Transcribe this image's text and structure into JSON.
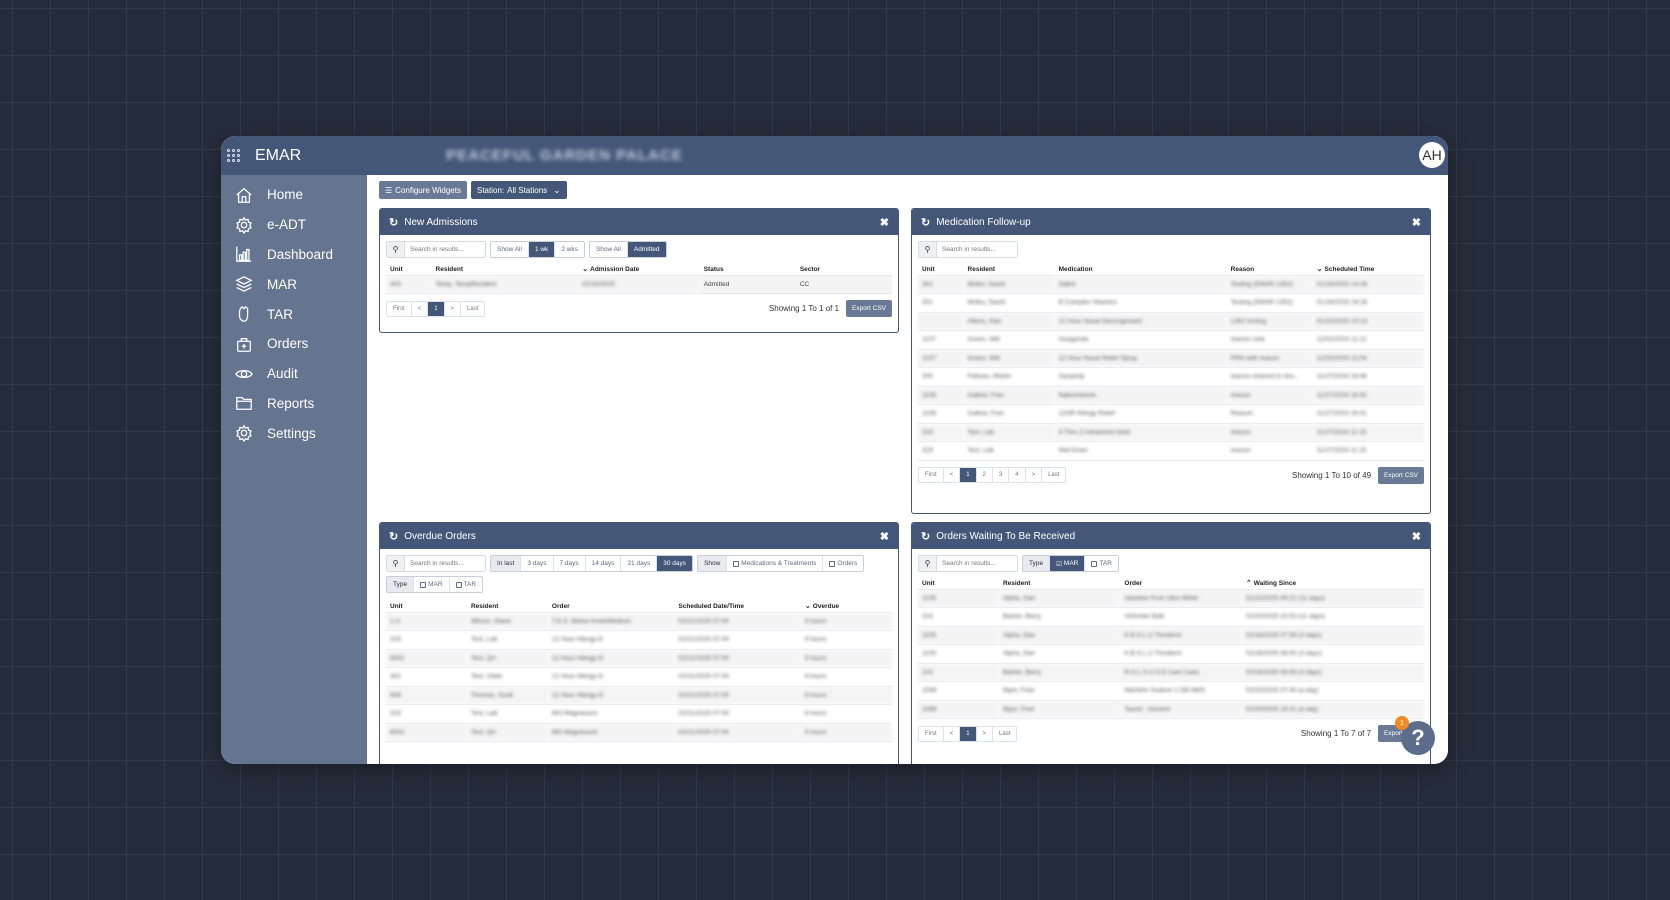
{
  "app": {
    "title": "EMAR",
    "facility_name": "PEACEFUL GARDEN PALACE",
    "avatar_initials": "AH"
  },
  "sidebar": {
    "items": [
      {
        "label": "Home",
        "icon": "home-icon"
      },
      {
        "label": "e-ADT",
        "icon": "gear-icon"
      },
      {
        "label": "Dashboard",
        "icon": "bar-chart-icon"
      },
      {
        "label": "MAR",
        "icon": "layers-icon"
      },
      {
        "label": "TAR",
        "icon": "hand-icon"
      },
      {
        "label": "Orders",
        "icon": "medical-bag-icon"
      },
      {
        "label": "Audit",
        "icon": "eye-icon"
      },
      {
        "label": "Reports",
        "icon": "folder-icon"
      },
      {
        "label": "Settings",
        "icon": "gear-icon"
      }
    ]
  },
  "toolbar": {
    "configure_label": "Configure Widgets",
    "station_label": "Station:",
    "station_value": "All Stations"
  },
  "widgets": {
    "new_admissions": {
      "title": "New Admissions",
      "search_placeholder": "Search in results...",
      "range_options": [
        "Show All",
        "1 wk",
        "2 wks"
      ],
      "range_selected": "1 wk",
      "status_options": [
        "Show All",
        "Admitted"
      ],
      "status_selected": "Admitted",
      "columns": [
        "Unit",
        "Resident",
        "Admission Date",
        "Status",
        "Sector"
      ],
      "sorted_column": "Admission Date",
      "rows": [
        [
          "303",
          "Temp, TempResident",
          "02/15/2025",
          "Admitted",
          "CC"
        ]
      ],
      "pager": [
        "First",
        "<",
        "1",
        ">",
        "Last"
      ],
      "current_page": "1",
      "showing": "Showing 1 To 1 of 1",
      "export_label": "Export CSV"
    },
    "medication_followup": {
      "title": "Medication Follow-up",
      "search_placeholder": "Search in results...",
      "columns": [
        "Unit",
        "Resident",
        "Medication",
        "Reason",
        "Scheduled Time"
      ],
      "sorted_column": "Scheduled Time",
      "rows": [
        [
          "301",
          "Molko, David",
          "Sabril",
          "Testing (EMAR-1352)",
          "01/16/2025 14:26"
        ],
        [
          "301",
          "Molko, David",
          "B Complex Vitamins",
          "Testing (EMAR-1352)",
          "01/16/2025 16:26"
        ],
        [
          "",
          "Allens, Alan",
          "12 Hour Nasal Decongestant",
          "1352 testing",
          "01/15/2025 10:13"
        ],
        [
          "1107",
          "Green, Will",
          "Hseganda",
          "reason note",
          "12/02/2024 11:21"
        ],
        [
          "1107",
          "Green, Will",
          "12 Hour Nasal Relief Spray",
          "PRN with reason",
          "12/02/2024 11:04"
        ],
        [
          "200",
          "Fellows, Martin",
          "Gynjardy",
          "reason entered to sho...",
          "11/27/2024 16:48"
        ],
        [
          "1106",
          "Gallow, Fran",
          "Nabumetone",
          "reason",
          "11/27/2024 16:42"
        ],
        [
          "1106",
          "Gallow, Fran",
          "12HR Allergy Relief",
          "Reason",
          "11/27/2024 16:41"
        ],
        [
          "319",
          "Test, Lab",
          "A Thru Z Advanced Adult",
          "reason",
          "11/27/2024 11:15"
        ],
        [
          "319",
          "Test, Lab",
          "Wal-Dram",
          "reason",
          "11/27/2024 11:15"
        ]
      ],
      "pager": [
        "First",
        "<",
        "1",
        "2",
        "3",
        "4",
        ">",
        "Last"
      ],
      "current_page": "1",
      "showing": "Showing 1 To 10 of 49",
      "export_label": "Export CSV"
    },
    "overdue_orders": {
      "title": "Overdue Orders",
      "search_placeholder": "Search in results...",
      "in_last_label": "In last",
      "in_last_options": [
        "3 days",
        "7 days",
        "14 days",
        "21 days",
        "30 days"
      ],
      "in_last_selected": "30 days",
      "show_label": "Show",
      "show_options": [
        "Medications & Treatments",
        "Orders"
      ],
      "type_label": "Type",
      "type_options": [
        "MAR",
        "TAR"
      ],
      "columns": [
        "Unit",
        "Resident",
        "Order",
        "Scheduled Date/Time",
        "Overdue"
      ],
      "sorted_column": "Overdue",
      "rows": [
        [
          "1-A",
          "Wilson, Diane",
          "T.E.D. Below Knee/Medium",
          "02/21/2025 07:00",
          "9 hours"
        ],
        [
          "319",
          "Test, Lab",
          "12 Hour Allergy-D",
          "02/21/2025 07:00",
          "9 hours"
        ],
        [
          "6002",
          "Test, QA",
          "12 Hour Allergy-D",
          "02/21/2025 07:00",
          "9 hours"
        ],
        [
          "302",
          "Test, Vitals",
          "12 Hour Allergy-D",
          "02/21/2025 07:00",
          "9 hours"
        ],
        [
          "908",
          "Thomas, Scott",
          "12 Hour Allergy-D",
          "02/21/2025 07:00",
          "9 hours"
        ],
        [
          "319",
          "Test, Lab",
          "MO Magnesium",
          "02/21/2025 07:00",
          "9 hours"
        ],
        [
          "6002",
          "Test, QA",
          "MO Magnesium",
          "02/21/2025 07:00",
          "9 hours"
        ]
      ]
    },
    "orders_waiting": {
      "title": "Orders Waiting To Be Received",
      "search_placeholder": "Search in results...",
      "type_label": "Type",
      "type_options": [
        "MAR",
        "TAR"
      ],
      "type_checked": "MAR",
      "columns": [
        "Unit",
        "Resident",
        "Order",
        "Waiting Since"
      ],
      "sorted_column": "Waiting Since",
      "rows": [
        [
          "1105",
          "Alpha, Dan",
          "Vaseline Pure Ultra White",
          "02/10/2025 09:22 (11 days)"
        ],
        [
          "223",
          "Barker, Barry",
          "Vohmiter Balk",
          "02/10/2025 15:53 (11 days)"
        ],
        [
          "1105",
          "Alpha, Dan",
          "K.B.S.L.U Tinoderm",
          "02/18/2025 07:59 (3 days)"
        ],
        [
          "1105",
          "Alpha, Dan",
          "K.B.S.L.U Tinoderm",
          "02/18/2025 08:00 (3 days)"
        ],
        [
          "223",
          "Barker, Barry",
          "R.G.L.S.U.S.E Care Case",
          "02/18/2025 08:08 (3 days)"
        ],
        [
          "1058",
          "Myer, Fred",
          "Warfarin Sodium 1 DB NMS",
          "02/20/2025 07:40 (a day)"
        ],
        [
          "1058",
          "Myer, Fred",
          "Taurid - Generic",
          "02/20/2025 16:31 (a day)"
        ]
      ],
      "pager": [
        "First",
        "<",
        "1",
        ">",
        "Last"
      ],
      "current_page": "1",
      "showing": "Showing 1 To 7 of 7",
      "export_label": "Export CSV"
    }
  },
  "help": {
    "label": "?",
    "badge_count": "1",
    "badge_color": "#f08a24"
  },
  "colors": {
    "brand": "#445779",
    "sidebar": "#65748f",
    "export_button": "#6a7a96"
  }
}
